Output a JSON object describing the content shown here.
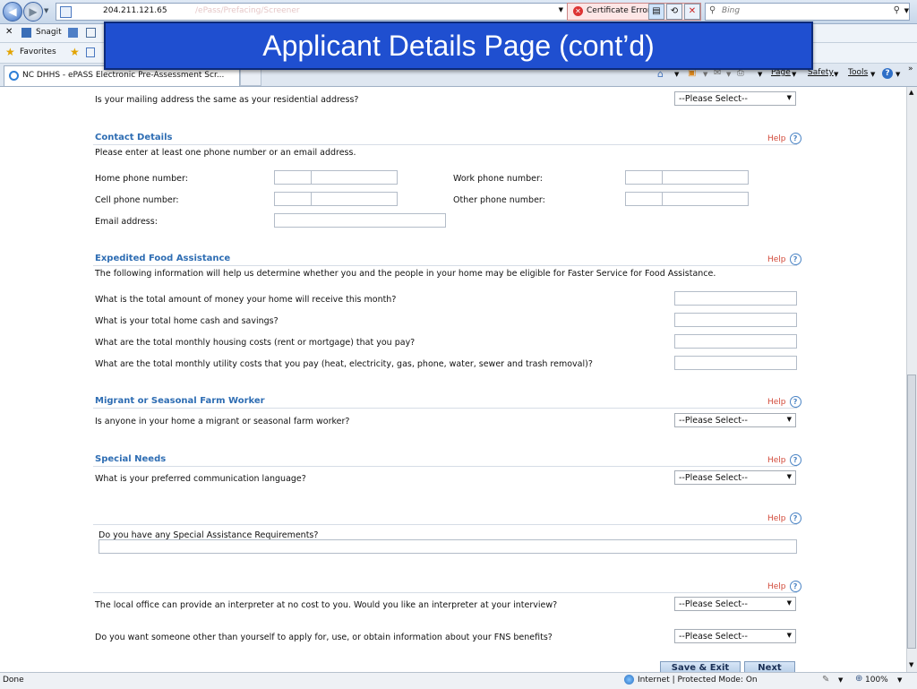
{
  "browser": {
    "url": "204.211.121.65",
    "url_faded": "/ePass/Prefacing/Screener",
    "cert_error": "Certificate Error",
    "search_placeholder": "Bing",
    "snagit_label": "Snagit",
    "favorites_label": "Favorites",
    "tab_title": "NC DHHS - ePASS Electronic Pre-Assessment Scr...",
    "menu": {
      "page": "Page",
      "safety": "Safety",
      "tools": "Tools"
    }
  },
  "slide_title": "Applicant Details Page (cont’d)",
  "mailing": {
    "question": "Is your mailing address the same as your residential address?",
    "select": "--Please Select--"
  },
  "contact": {
    "title": "Contact Details",
    "help": "Help",
    "instruction": "Please enter at least one phone number or an email address.",
    "home_phone": "Home phone number:",
    "work_phone": "Work phone number:",
    "cell_phone": "Cell phone number:",
    "other_phone": "Other phone number:",
    "email": "Email address:"
  },
  "expedited": {
    "title": "Expedited Food Assistance",
    "help": "Help",
    "instruction": "The following information will help us determine whether you and the people in your home may be eligible for Faster Service for Food Assistance.",
    "q1": "What is the total amount of money your home will receive this month?",
    "q2": "What is your total home cash and savings?",
    "q3": "What are the total monthly housing costs (rent or mortgage) that you pay?",
    "q4": "What are the total monthly utility costs that you pay (heat, electricity, gas, phone, water, sewer and trash removal)?"
  },
  "migrant": {
    "title": "Migrant or Seasonal Farm Worker",
    "help": "Help",
    "question": "Is anyone in your home a migrant or seasonal farm worker?",
    "select": "--Please Select--"
  },
  "special": {
    "title": "Special Needs",
    "help": "Help",
    "question": "What is your preferred communication language?",
    "select": "--Please Select--",
    "help2": "Help",
    "requirements": "Do you have any Special Assistance Requirements?"
  },
  "interpreter": {
    "help": "Help",
    "question": "The local office can provide an interpreter at no cost to you. Would you like an interpreter at your interview?",
    "select": "--Please Select--",
    "fns_question": "Do you want someone other than yourself to apply for, use, or obtain information about your FNS benefits?",
    "fns_select": "--Please Select--"
  },
  "buttons": {
    "save_exit": "Save & Exit",
    "next": "Next"
  },
  "status": {
    "done": "Done",
    "zone": "Internet | Protected Mode: On",
    "zoom": "100%"
  }
}
